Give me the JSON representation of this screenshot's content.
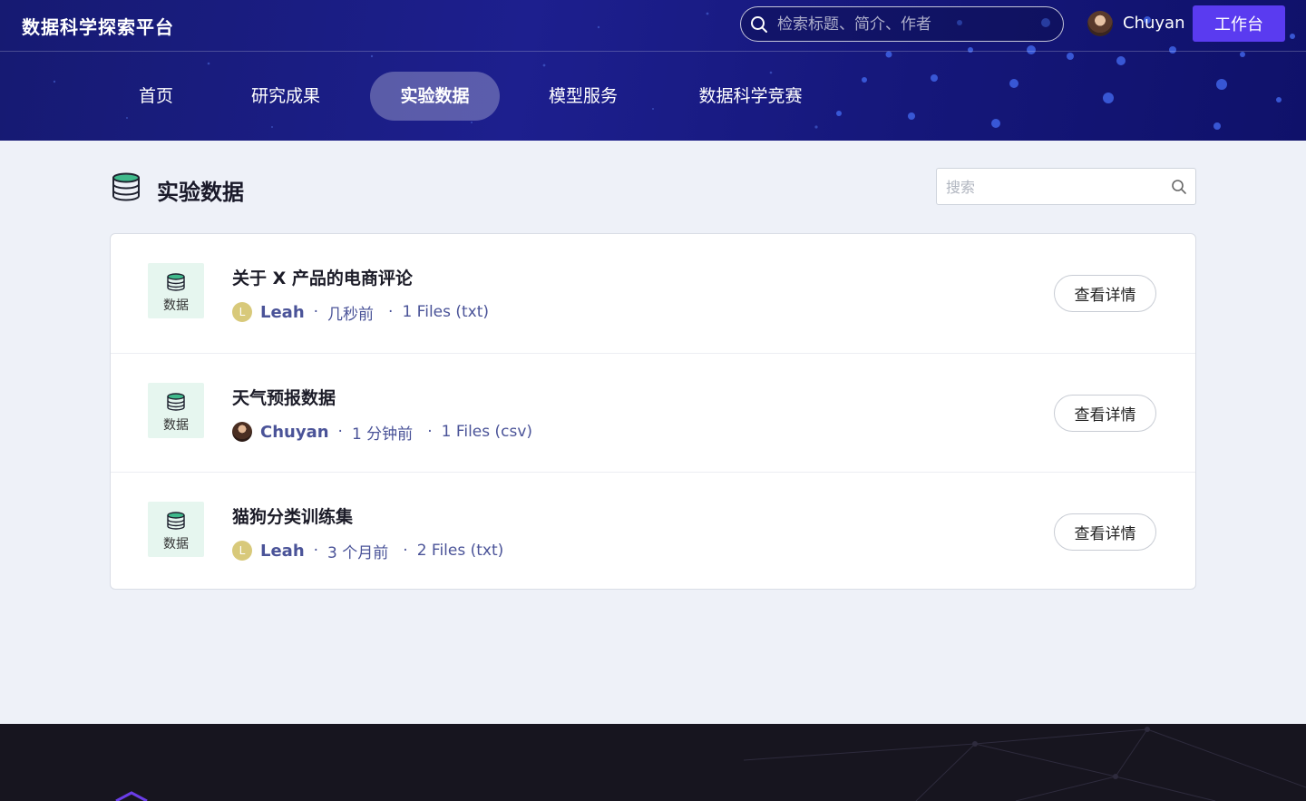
{
  "header": {
    "brand": "数据科学探索平台",
    "search_placeholder": "检索标题、简介、作者",
    "user_name": "Chuyan",
    "workbench_label": "工作台",
    "nav": [
      {
        "label": "首页"
      },
      {
        "label": "研究成果"
      },
      {
        "label": "实验数据",
        "active": true
      },
      {
        "label": "模型服务"
      },
      {
        "label": "数据科学竞赛"
      }
    ]
  },
  "main": {
    "title": "实验数据",
    "search_placeholder": "搜索",
    "items": [
      {
        "badge": "数据",
        "title": "关于 X 产品的电商评论",
        "author_initial": "L",
        "author": "Leah",
        "time": "几秒前",
        "files": "1 Files (txt)",
        "button": "查看详情"
      },
      {
        "badge": "数据",
        "title": "天气预报数据",
        "author_initial": "",
        "author": "Chuyan",
        "time": "1 分钟前",
        "files": "1 Files (csv)",
        "button": "查看详情"
      },
      {
        "badge": "数据",
        "title": "猫狗分类训练集",
        "author_initial": "L",
        "author": "Leah",
        "time": "3 个月前",
        "files": "2 Files (txt)",
        "button": "查看详情"
      }
    ]
  },
  "colors": {
    "header_bg": "#1d1f8e",
    "accent_button": "#5a3bf0",
    "meta_text": "#4a5398",
    "badge_bg": "#e6f6ef",
    "footer_bg": "#17151f"
  },
  "icons": {
    "global_search": "search-icon",
    "title": "database-icon",
    "badge": "database-icon"
  }
}
